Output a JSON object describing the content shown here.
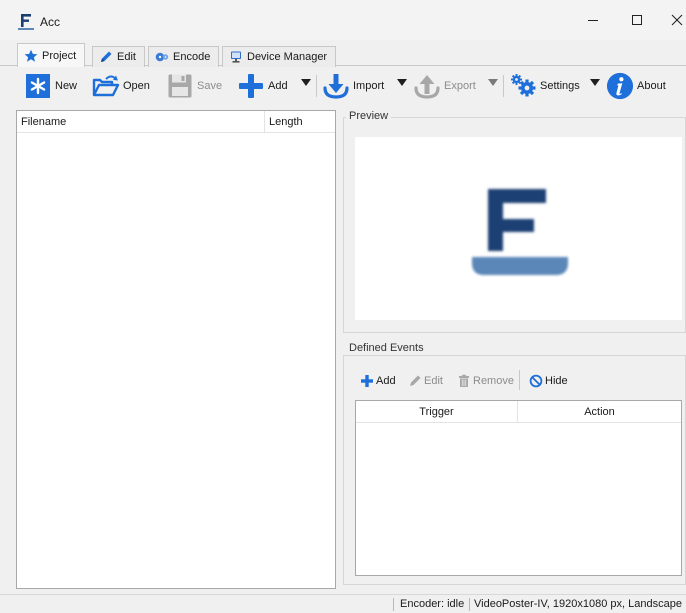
{
  "window": {
    "title": "Acc",
    "minimize": "—",
    "maximize": "☐",
    "close": "✕"
  },
  "tabs": [
    {
      "label": "Project",
      "icon": "star-icon",
      "active": true
    },
    {
      "label": "Edit",
      "icon": "pencil-icon"
    },
    {
      "label": "Encode",
      "icon": "film-reel-icon"
    },
    {
      "label": "Device Manager",
      "icon": "computer-icon"
    }
  ],
  "toolbar": {
    "new": "New",
    "open": "Open",
    "save": "Save",
    "add": "Add",
    "import": "Import",
    "export": "Export",
    "settings": "Settings",
    "about": "About"
  },
  "file_list": {
    "columns": [
      "Filename",
      "Length"
    ],
    "rows": []
  },
  "preview": {
    "title": "Preview"
  },
  "events": {
    "title": "Defined Events",
    "add": "Add",
    "edit": "Edit",
    "remove": "Remove",
    "hide": "Hide",
    "columns": [
      "Trigger",
      "Action"
    ],
    "rows": []
  },
  "status": {
    "encoder": "Encoder: idle",
    "device": "VideoPoster-IV, 1920x1080 px, Landscape"
  },
  "colors": {
    "accent_blue": "#1e6fd9",
    "logo_navy": "#1c3f73",
    "logo_base": "#5a86b8"
  }
}
